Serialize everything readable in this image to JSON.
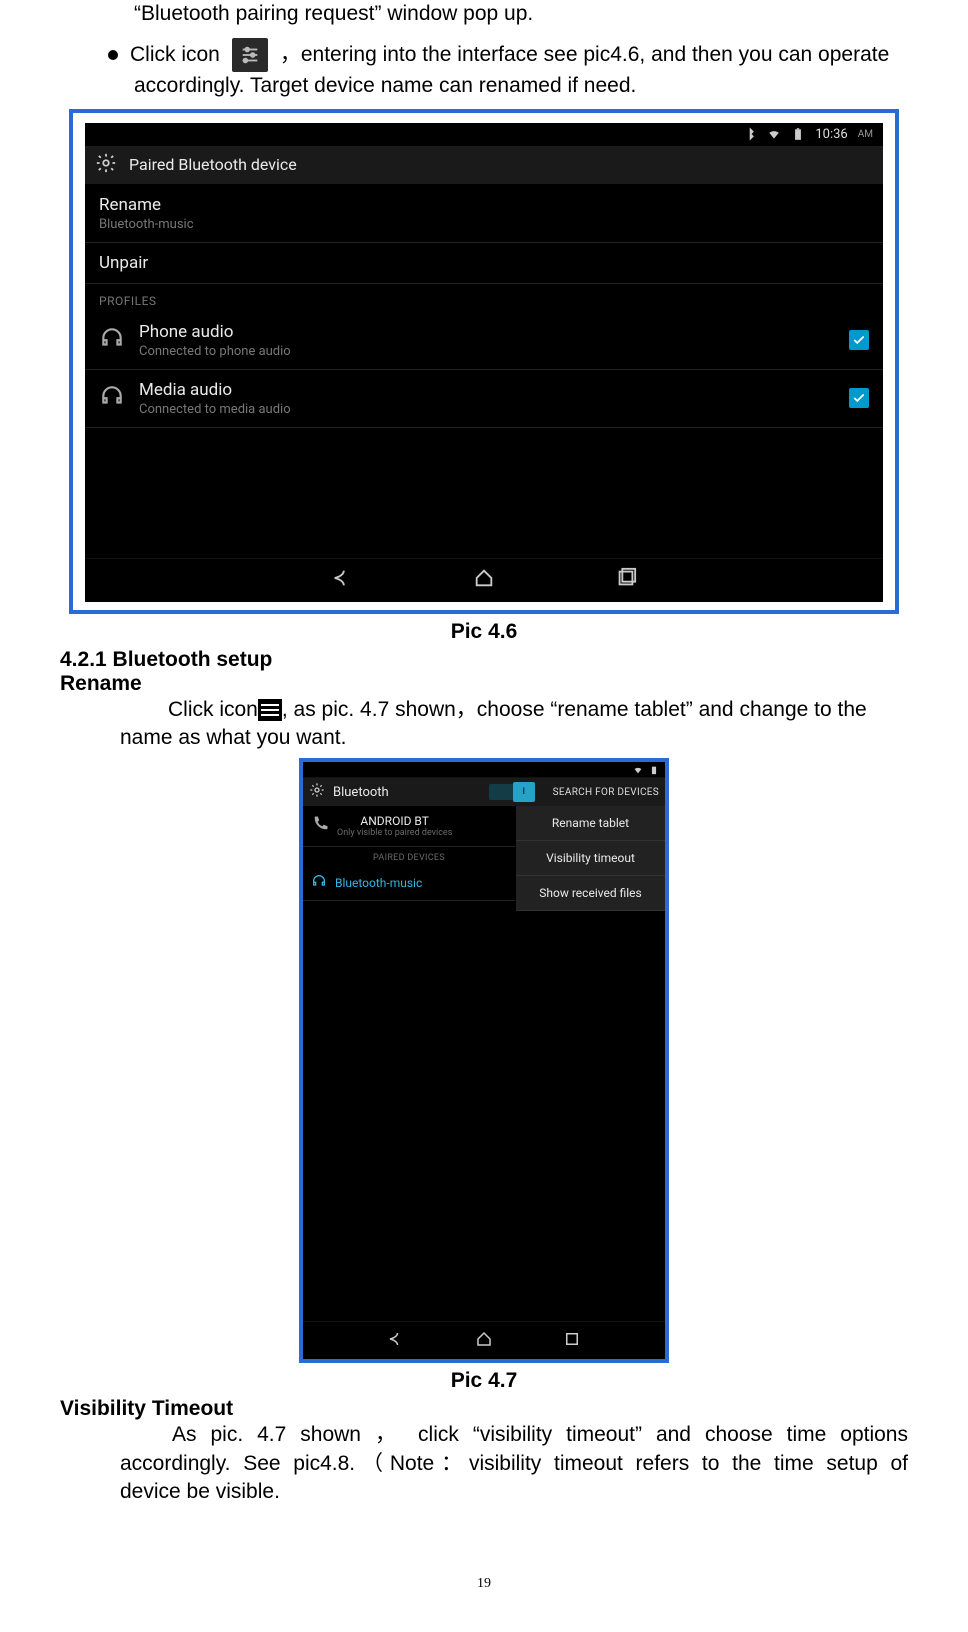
{
  "intro": {
    "line1": "“Bluetooth pairing request” window pop up.",
    "bullet_pre": "Click icon",
    "bullet_post": "，entering into the interface see pic4.6, and then you can operate",
    "bullet_cont": "accordingly. Target device name can renamed if need."
  },
  "shot46": {
    "status_time": "10:36",
    "status_ampm": "AM",
    "appbar_title": "Paired Bluetooth device",
    "rename_label": "Rename",
    "rename_sub": "Bluetooth-music",
    "unpair_label": "Unpair",
    "profiles_label": "PROFILES",
    "phone_audio_title": "Phone audio",
    "phone_audio_sub": "Connected to phone audio",
    "media_audio_title": "Media audio",
    "media_audio_sub": "Connected to media audio"
  },
  "caption46": "Pic 4.6",
  "section": {
    "title": "4.2.1 Bluetooth setup",
    "rename_heading": "Rename",
    "rename_text_pre": "Click icon",
    "rename_text_post": ", as pic. 4.7 shown，choose “rename tablet” and change to the",
    "rename_text_cont": "name as what you want."
  },
  "shot47": {
    "appbar_title": "Bluetooth",
    "toggle_text": "I",
    "search_label": "SEARCH FOR DEVICES",
    "device_title": "ANDROID BT",
    "device_sub": "Only visible to paired devices",
    "paired_label": "PAIRED DEVICES",
    "paired_item": "Bluetooth-music",
    "menu": [
      "Rename tablet",
      "Visibility timeout",
      "Show received files"
    ]
  },
  "caption47": "Pic 4.7",
  "visibility": {
    "heading": "Visibility Timeout",
    "line1": "As pic. 4.7 shown ， click “visibility timeout” and choose time options",
    "line2": "accordingly. See pic4.8.（Note：visibility timeout refers to the time setup of",
    "line3": "device be visible."
  },
  "page_number": "19"
}
